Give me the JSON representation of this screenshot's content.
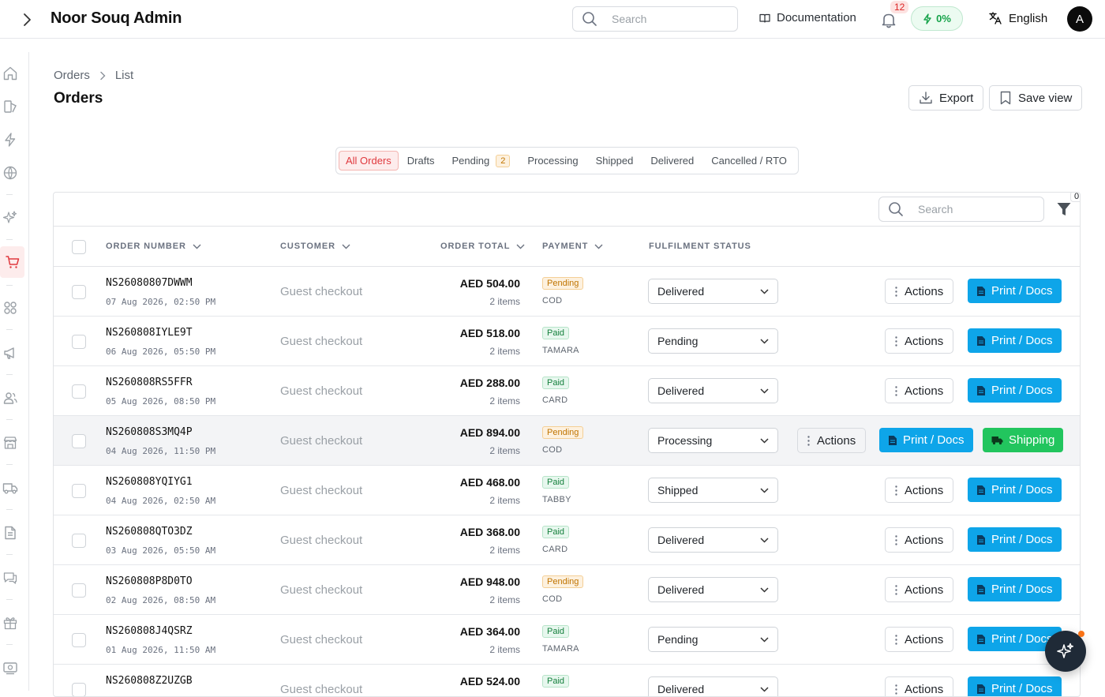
{
  "app": {
    "title": "Noor Souq Admin"
  },
  "header": {
    "search_placeholder": "Search",
    "documentation": "Documentation",
    "notifications": "12",
    "power": "0%",
    "language": "English",
    "avatar": "A"
  },
  "breadcrumb": {
    "root": "Orders",
    "current": "List"
  },
  "page": {
    "title": "Orders",
    "export": "Export",
    "save_view": "Save view"
  },
  "tabs": [
    {
      "label": "All Orders"
    },
    {
      "label": "Drafts"
    },
    {
      "label": "Pending",
      "count": "2"
    },
    {
      "label": "Processing"
    },
    {
      "label": "Shipped"
    },
    {
      "label": "Delivered"
    },
    {
      "label": "Cancelled / RTO"
    }
  ],
  "table": {
    "search_placeholder": "Search",
    "filter_count": "0",
    "columns": {
      "order_number": "ORDER NUMBER",
      "customer": "CUSTOMER",
      "order_total": "ORDER TOTAL",
      "payment": "PAYMENT",
      "fulfilment": "FULFILMENT STATUS"
    },
    "actions_label": "Actions",
    "print_label": "Print / Docs",
    "shipping_label": "Shipping",
    "rows": [
      {
        "order": "NS26080807DWWM",
        "date": "07 Aug 2026, 02:50 PM",
        "customer": "Guest checkout",
        "total": "AED 504.00",
        "items": "2 items",
        "pay_status": "Pending",
        "pay_method": "COD",
        "fulfil": "Delivered"
      },
      {
        "order": "NS260808IYLE9T",
        "date": "06 Aug 2026, 05:50 PM",
        "customer": "Guest checkout",
        "total": "AED 518.00",
        "items": "2 items",
        "pay_status": "Paid",
        "pay_method": "TAMARA",
        "fulfil": "Pending"
      },
      {
        "order": "NS260808RS5FFR",
        "date": "05 Aug 2026, 08:50 PM",
        "customer": "Guest checkout",
        "total": "AED 288.00",
        "items": "2 items",
        "pay_status": "Paid",
        "pay_method": "CARD",
        "fulfil": "Delivered"
      },
      {
        "order": "NS260808S3MQ4P",
        "date": "04 Aug 2026, 11:50 PM",
        "customer": "Guest checkout",
        "total": "AED 894.00",
        "items": "2 items",
        "pay_status": "Pending",
        "pay_method": "COD",
        "fulfil": "Processing"
      },
      {
        "order": "NS260808YQIYG1",
        "date": "04 Aug 2026, 02:50 AM",
        "customer": "Guest checkout",
        "total": "AED 468.00",
        "items": "2 items",
        "pay_status": "Paid",
        "pay_method": "TABBY",
        "fulfil": "Shipped"
      },
      {
        "order": "NS260808QTO3DZ",
        "date": "03 Aug 2026, 05:50 AM",
        "customer": "Guest checkout",
        "total": "AED 368.00",
        "items": "2 items",
        "pay_status": "Paid",
        "pay_method": "CARD",
        "fulfil": "Delivered"
      },
      {
        "order": "NS260808P8D0TO",
        "date": "02 Aug 2026, 08:50 AM",
        "customer": "Guest checkout",
        "total": "AED 948.00",
        "items": "2 items",
        "pay_status": "Pending",
        "pay_method": "COD",
        "fulfil": "Delivered"
      },
      {
        "order": "NS260808J4QSRZ",
        "date": "01 Aug 2026, 11:50 AM",
        "customer": "Guest checkout",
        "total": "AED 364.00",
        "items": "2 items",
        "pay_status": "Paid",
        "pay_method": "TAMARA",
        "fulfil": "Pending"
      },
      {
        "order": "NS260808Z2UZGB",
        "date": "",
        "customer": "Guest checkout",
        "total": "AED 524.00",
        "items": "",
        "pay_status": "Paid",
        "pay_method": "",
        "fulfil": "Delivered"
      }
    ]
  },
  "colors": {
    "accent": "#e0393e",
    "print": "#0ea5e9",
    "shipping": "#22c55e"
  },
  "sidebar_icons": [
    "home-icon",
    "catalog-icon",
    "flash-icon",
    "globe-icon",
    "sparkles-icon",
    "cart-icon",
    "apps-icon",
    "megaphone-icon",
    "users-icon",
    "store-icon",
    "truck-icon",
    "document-icon",
    "chat-icon",
    "gift-icon",
    "media-icon"
  ]
}
